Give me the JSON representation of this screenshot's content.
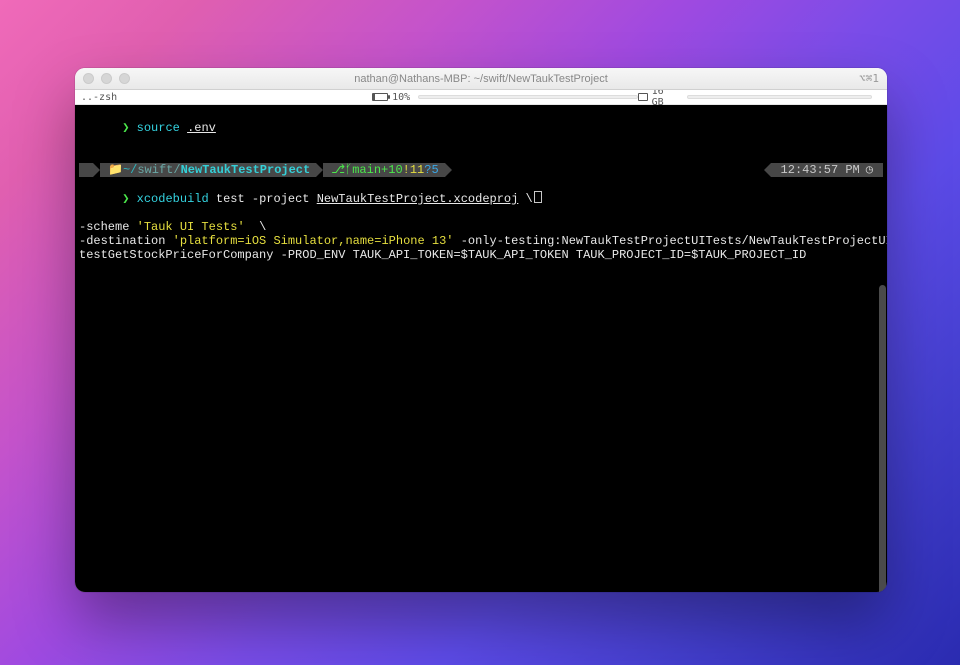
{
  "titlebar": {
    "title": "nathan@Nathans-MBP: ~/swift/NewTaukTestProject",
    "right_indicator": "⌥⌘1"
  },
  "infostrip": {
    "shell_label": "..-zsh",
    "battery_pct": "10%",
    "ram_label": "16 GB"
  },
  "line1": {
    "prompt": "❯",
    "cmd": "source",
    "arg": ".env"
  },
  "status": {
    "apple_glyph": "",
    "path_prefix": "~/",
    "path_mid": "swift/",
    "path_leaf": "NewTaukTestProject",
    "git_icon": "⎇",
    "branch_icon": "ᚶ",
    "branch": "main",
    "ahead": "+10",
    "excl": "!11",
    "untracked": "?5",
    "time": "12:43:57 PM",
    "clock_glyph": "◷"
  },
  "cmd": {
    "prompt": "❯",
    "bin": "xcodebuild",
    "w1": "test",
    "w2": "-project",
    "proj": "NewTaukTestProject.xcodeproj",
    "cont": "\\",
    "l2a": "-scheme",
    "l2b": "'Tauk UI Tests'",
    "l2c": "\\",
    "l3a": "-destination",
    "l3b": "'platform=iOS Simulator,name=iPhone 13'",
    "l3c": "-only-testing:NewTaukTestProjectUITests/NewTaukTestProjectUITests/",
    "l4": "testGetStockPriceForCompany -PROD_ENV TAUK_API_TOKEN=$TAUK_API_TOKEN TAUK_PROJECT_ID=$TAUK_PROJECT_ID"
  }
}
